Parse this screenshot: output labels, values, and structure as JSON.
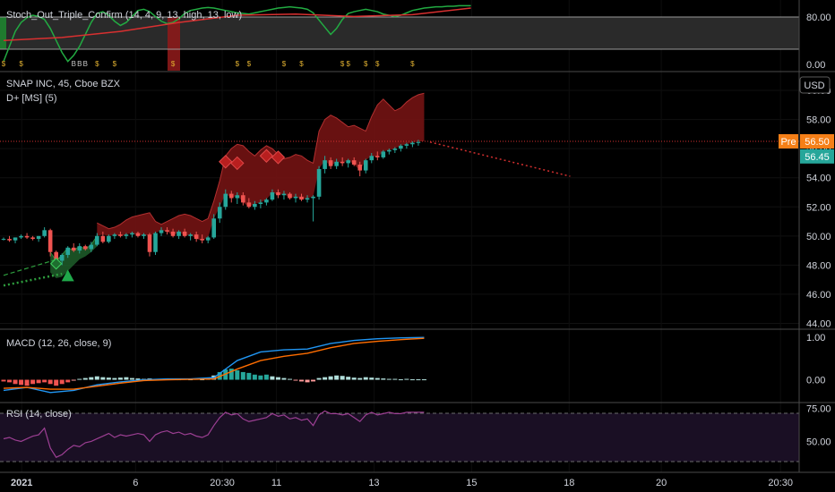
{
  "colors": {
    "background": "#000000",
    "up": "#26a69a",
    "down": "#ef5350",
    "axis_text": "#d1d4dc",
    "stoch_green": "#22ab42",
    "stoch_red": "#d93030",
    "macd_line": "#2196f3",
    "signal_line": "#ff6d00",
    "rsi_line": "#9c3f93",
    "pre_badge": "#f57f17",
    "last_badge": "#26a69a",
    "cloud_red": "#7a1414",
    "cloud_green": "#1e5e2a",
    "dot_green": "#2e9e3e",
    "dot_red": "#d32f2f"
  },
  "chart_data": [
    {
      "id": "stoch-pane",
      "type": "line",
      "title": "Stoch_Out_Triple_Confirm (14, 4, 9, 13, high, 13, low)",
      "yticks": [
        "80.00",
        "0.00"
      ],
      "series": [
        {
          "color_key": "stoch_green",
          "x": [
            0,
            1,
            2,
            3,
            4,
            5,
            6,
            7,
            8,
            9,
            10,
            11,
            12,
            13,
            14,
            15,
            16,
            17,
            18,
            19,
            20,
            21,
            22,
            23,
            24,
            25,
            26,
            27,
            28,
            29,
            30,
            31,
            32,
            33,
            34,
            35,
            36,
            37,
            38,
            39,
            40,
            41,
            42,
            43,
            44,
            45,
            46,
            47,
            48,
            49,
            50,
            51,
            52,
            53,
            54,
            55,
            56,
            57,
            58,
            59,
            60,
            61,
            62,
            63,
            64,
            65,
            66,
            67,
            68,
            69,
            70,
            71,
            72,
            73,
            74,
            75,
            76,
            77,
            78,
            79,
            80
          ],
          "values": [
            5,
            30,
            55,
            70,
            78,
            82,
            80,
            75,
            60,
            40,
            20,
            5,
            15,
            30,
            50,
            70,
            85,
            88,
            82,
            72,
            65,
            70,
            80,
            90,
            92,
            88,
            80,
            72,
            68,
            70,
            76,
            85,
            90,
            92,
            94,
            95,
            94,
            92,
            90,
            88,
            86,
            85,
            84,
            86,
            88,
            90,
            92,
            94,
            95,
            96,
            95,
            94,
            92,
            86,
            74,
            62,
            50,
            60,
            75,
            85,
            88,
            90,
            92,
            90,
            88,
            84,
            82,
            80,
            82,
            86,
            90,
            92,
            94,
            95,
            96,
            96,
            97,
            97,
            98,
            98,
            98
          ]
        },
        {
          "color_key": "stoch_red",
          "x": [
            0,
            10,
            20,
            30,
            40,
            50,
            60,
            70,
            80
          ],
          "values": [
            40,
            45,
            55,
            70,
            82,
            84,
            80,
            83,
            94
          ]
        }
      ]
    },
    {
      "id": "price-pane",
      "type": "candlestick",
      "title": "SNAP INC, 45, Cboe BZX",
      "subtitle": "D+ [MS] (5)",
      "ylim": [
        43.6,
        60.8
      ],
      "yticks": [
        "60.00",
        "58.00",
        "56.00",
        "54.00",
        "52.00",
        "50.00",
        "48.00",
        "46.00",
        "44.00"
      ],
      "pre_price": "56.50",
      "pre_label": "Pre",
      "last_price": "56.45",
      "currency": "USD",
      "candles": [
        [
          49.8,
          49.9,
          49.7,
          49.8
        ],
        [
          49.8,
          50.0,
          49.6,
          49.7
        ],
        [
          49.7,
          49.9,
          49.5,
          49.9
        ],
        [
          49.9,
          50.1,
          49.8,
          50.0
        ],
        [
          50.0,
          50.2,
          49.8,
          49.9
        ],
        [
          49.9,
          50.0,
          49.7,
          49.8
        ],
        [
          49.8,
          50.0,
          49.6,
          50.0
        ],
        [
          50.0,
          50.6,
          49.9,
          50.4
        ],
        [
          50.4,
          50.5,
          48.6,
          48.9
        ],
        [
          48.9,
          49.0,
          48.0,
          48.3
        ],
        [
          48.3,
          48.8,
          48.0,
          48.7
        ],
        [
          48.7,
          49.3,
          48.5,
          49.2
        ],
        [
          49.2,
          49.5,
          48.9,
          49.0
        ],
        [
          49.0,
          49.5,
          48.8,
          49.3
        ],
        [
          49.3,
          49.4,
          49.0,
          49.1
        ],
        [
          49.1,
          49.6,
          48.9,
          49.4
        ],
        [
          49.4,
          50.2,
          49.3,
          50.0
        ],
        [
          50.0,
          50.3,
          49.5,
          49.6
        ],
        [
          49.6,
          50.1,
          49.5,
          50.0
        ],
        [
          50.0,
          50.2,
          49.8,
          50.1
        ],
        [
          50.1,
          50.3,
          49.9,
          50.0
        ],
        [
          50.0,
          50.2,
          49.8,
          50.1
        ],
        [
          50.1,
          50.3,
          49.9,
          50.2
        ],
        [
          50.2,
          50.3,
          49.9,
          50.0
        ],
        [
          50.0,
          50.2,
          49.8,
          50.1
        ],
        [
          50.1,
          50.2,
          48.6,
          48.9
        ],
        [
          48.9,
          50.3,
          48.7,
          50.2
        ],
        [
          50.2,
          50.6,
          50.0,
          50.4
        ],
        [
          50.4,
          50.6,
          50.1,
          50.3
        ],
        [
          50.3,
          50.5,
          49.9,
          50.0
        ],
        [
          50.0,
          50.4,
          49.8,
          50.3
        ],
        [
          50.3,
          50.5,
          49.9,
          50.0
        ],
        [
          50.0,
          50.2,
          49.7,
          50.1
        ],
        [
          50.1,
          50.3,
          49.6,
          49.8
        ],
        [
          49.8,
          50.1,
          49.5,
          49.7
        ],
        [
          49.7,
          50.0,
          49.5,
          49.9
        ],
        [
          49.9,
          51.5,
          49.8,
          51.2
        ],
        [
          51.2,
          52.3,
          50.9,
          52.0
        ],
        [
          52.0,
          53.2,
          51.8,
          52.9
        ],
        [
          52.9,
          53.1,
          52.3,
          52.6
        ],
        [
          52.6,
          53.0,
          52.2,
          52.8
        ],
        [
          52.8,
          53.0,
          52.1,
          52.3
        ],
        [
          52.3,
          52.6,
          51.9,
          52.0
        ],
        [
          52.0,
          52.4,
          51.8,
          52.2
        ],
        [
          52.2,
          52.5,
          51.9,
          52.3
        ],
        [
          52.3,
          52.6,
          52.1,
          52.5
        ],
        [
          52.5,
          53.2,
          52.4,
          53.0
        ],
        [
          53.0,
          53.2,
          52.6,
          52.8
        ],
        [
          52.8,
          53.1,
          52.5,
          52.9
        ],
        [
          52.9,
          53.0,
          52.5,
          52.6
        ],
        [
          52.6,
          52.9,
          52.3,
          52.7
        ],
        [
          52.7,
          52.9,
          52.4,
          52.5
        ],
        [
          52.5,
          52.8,
          52.3,
          52.6
        ],
        [
          52.6,
          52.8,
          51.0,
          52.7
        ],
        [
          52.7,
          54.8,
          52.5,
          54.6
        ],
        [
          54.6,
          55.5,
          54.3,
          55.2
        ],
        [
          55.2,
          55.4,
          54.6,
          54.8
        ],
        [
          54.8,
          55.3,
          54.6,
          55.1
        ],
        [
          55.1,
          55.4,
          54.8,
          55.0
        ],
        [
          55.0,
          55.3,
          54.7,
          55.2
        ],
        [
          55.2,
          55.4,
          54.8,
          54.9
        ],
        [
          54.9,
          55.1,
          54.1,
          54.5
        ],
        [
          54.5,
          55.3,
          54.3,
          55.2
        ],
        [
          55.2,
          55.7,
          55.0,
          55.5
        ],
        [
          55.5,
          55.8,
          55.2,
          55.4
        ],
        [
          55.4,
          55.9,
          55.3,
          55.8
        ],
        [
          55.8,
          56.0,
          55.6,
          55.9
        ],
        [
          55.9,
          56.1,
          55.7,
          56.0
        ],
        [
          56.0,
          56.3,
          55.8,
          56.2
        ],
        [
          56.2,
          56.4,
          56.0,
          56.3
        ],
        [
          56.3,
          56.5,
          56.1,
          56.4
        ],
        [
          56.4,
          56.6,
          56.2,
          56.45
        ]
      ],
      "pre_line_value": 56.5,
      "forecast": {
        "from": [
          73,
          56.45
        ],
        "to": [
          97,
          54.1
        ]
      },
      "cloud_red_upper": [
        null,
        null,
        null,
        null,
        null,
        null,
        null,
        null,
        null,
        null,
        null,
        null,
        null,
        null,
        null,
        null,
        50.9,
        50.7,
        50.5,
        50.6,
        50.8,
        51.1,
        51.3,
        51.4,
        51.5,
        51.6,
        51.0,
        50.8,
        51.0,
        51.2,
        51.4,
        51.5,
        51.4,
        51.2,
        51.0,
        51.2,
        52.4,
        53.8,
        55.5,
        56.0,
        56.3,
        56.2,
        55.8,
        55.5,
        55.9,
        56.2,
        56.0,
        55.6,
        55.3,
        55.4,
        55.6,
        55.5,
        55.2,
        55.0,
        57.2,
        58.0,
        58.3,
        58.1,
        57.8,
        57.5,
        57.6,
        57.4,
        57.2,
        58.2,
        59.0,
        59.4,
        59.0,
        58.6,
        58.8,
        59.2,
        59.5,
        59.7,
        59.8
      ],
      "cloud_red_lower": [
        null,
        null,
        null,
        null,
        null,
        null,
        null,
        null,
        null,
        null,
        null,
        null,
        null,
        null,
        null,
        null,
        50.0,
        50.1,
        50.0,
        50.1,
        50.0,
        50.1,
        50.2,
        50.0,
        50.1,
        50.0,
        50.2,
        50.4,
        50.3,
        50.0,
        50.3,
        50.0,
        50.1,
        49.8,
        49.7,
        49.9,
        51.2,
        52.0,
        52.9,
        52.6,
        52.8,
        52.3,
        52.0,
        52.2,
        52.3,
        52.5,
        53.0,
        52.8,
        52.9,
        52.6,
        52.7,
        52.5,
        52.6,
        52.7,
        54.6,
        55.2,
        54.8,
        55.1,
        55.0,
        55.2,
        54.9,
        54.5,
        55.2,
        55.5,
        55.4,
        55.8,
        55.9,
        56.0,
        56.2,
        56.3,
        56.4,
        56.5,
        56.5
      ],
      "cloud_green_upper": [
        null,
        null,
        null,
        null,
        null,
        null,
        null,
        null,
        48.9,
        48.3,
        48.7,
        49.2,
        49.0,
        49.3,
        49.1,
        49.4,
        50.0
      ],
      "cloud_green_lower": [
        null,
        null,
        null,
        null,
        null,
        null,
        null,
        null,
        47.5,
        47.1,
        47.2,
        47.6,
        48.0,
        48.4,
        48.6,
        48.9,
        49.3
      ],
      "dotted_green": {
        "x": [
          0,
          10
        ],
        "values": [
          46.6,
          47.4
        ]
      },
      "dashed_green": {
        "x": [
          0,
          10
        ],
        "values": [
          47.3,
          48.5
        ]
      },
      "up_triangle": {
        "x": 11,
        "value": 47.2
      },
      "diamond_green": {
        "x": 9,
        "value": 48.1
      },
      "diamonds_red": [
        {
          "x": 38,
          "value": 55.1
        },
        {
          "x": 40,
          "value": 55.0
        },
        {
          "x": 45,
          "value": 55.5
        },
        {
          "x": 47,
          "value": 55.4
        }
      ]
    },
    {
      "id": "macd-pane",
      "type": "line",
      "title": "MACD (12, 26, close, 9)",
      "yticks": [
        "1.00",
        "0.00"
      ],
      "ylim": [
        -0.45,
        1.1
      ],
      "x": [
        0,
        4,
        8,
        12,
        16,
        20,
        24,
        28,
        32,
        36,
        40,
        44,
        48,
        52,
        56,
        60,
        64,
        68,
        72
      ],
      "series": [
        {
          "color_key": "macd_line",
          "values": [
            -0.25,
            -0.18,
            -0.3,
            -0.25,
            -0.12,
            -0.05,
            0.0,
            0.02,
            0.02,
            0.05,
            0.45,
            0.65,
            0.7,
            0.72,
            0.85,
            0.92,
            0.96,
            0.98,
            0.99
          ]
        },
        {
          "color_key": "signal_line",
          "values": [
            -0.2,
            -0.18,
            -0.22,
            -0.22,
            -0.15,
            -0.08,
            -0.02,
            0.0,
            0.01,
            0.02,
            0.25,
            0.45,
            0.55,
            0.62,
            0.75,
            0.85,
            0.9,
            0.94,
            0.97
          ]
        }
      ],
      "histogram": [
        -0.04,
        -0.06,
        -0.1,
        -0.12,
        -0.14,
        -0.1,
        -0.08,
        -0.06,
        -0.1,
        -0.14,
        -0.1,
        -0.06,
        -0.02,
        0.02,
        0.04,
        0.06,
        0.08,
        0.06,
        0.05,
        0.04,
        0.05,
        0.06,
        0.04,
        0.03,
        0.02,
        0.03,
        0.01,
        0.02,
        0.03,
        0.02,
        0.01,
        0.02,
        0.01,
        0.02,
        0.01,
        0.02,
        0.1,
        0.18,
        0.24,
        0.26,
        0.22,
        0.18,
        0.16,
        0.12,
        0.1,
        0.12,
        0.08,
        0.06,
        0.04,
        0.02,
        -0.02,
        -0.04,
        -0.06,
        -0.04,
        0.04,
        0.06,
        0.08,
        0.1,
        0.09,
        0.07,
        0.05,
        0.04,
        0.06,
        0.05,
        0.04,
        0.03,
        0.02,
        0.02,
        0.01,
        0.02,
        0.01,
        0.01,
        0.01
      ]
    },
    {
      "id": "rsi-pane",
      "type": "line",
      "title": "RSI (14, close)",
      "yticks": [
        "75.00",
        "50.00"
      ],
      "ylim": [
        28,
        78
      ],
      "series": [
        {
          "color_key": "rsi_line",
          "values": [
            52,
            53,
            51,
            50,
            52,
            54,
            55,
            60,
            45,
            38,
            40,
            44,
            47,
            46,
            49,
            50,
            52,
            54,
            56,
            53,
            55,
            54,
            55,
            56,
            55,
            50,
            55,
            57,
            58,
            56,
            57,
            55,
            56,
            54,
            53,
            55,
            62,
            68,
            72,
            70,
            71,
            67,
            65,
            66,
            67,
            68,
            71,
            69,
            70,
            67,
            68,
            66,
            67,
            62,
            70,
            73,
            71,
            71,
            70,
            71,
            68,
            65,
            70,
            72,
            70,
            71,
            72,
            71,
            71,
            72,
            72,
            72,
            72
          ]
        }
      ]
    }
  ],
  "xaxis": {
    "labels": [
      {
        "text": "2021",
        "x": 4
      },
      {
        "text": "6",
        "x": 25
      },
      {
        "text": "20:30",
        "x": 41
      },
      {
        "text": "11",
        "x": 51
      },
      {
        "text": "13",
        "x": 69
      },
      {
        "text": "15",
        "x": 87
      },
      {
        "text": "18",
        "x": 105
      },
      {
        "text": "20",
        "x": 122
      },
      {
        "text": "20:30",
        "x": 144
      }
    ]
  }
}
